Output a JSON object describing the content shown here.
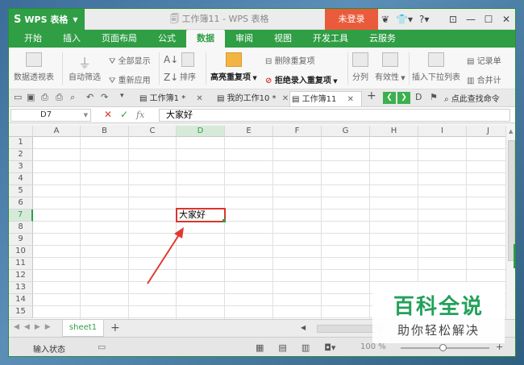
{
  "titlebar": {
    "app_name": "WPS 表格",
    "app_logo": "S",
    "title": "工作簿11 - WPS 表格",
    "login_label": "未登录",
    "icons": [
      "bird-icon",
      "shirt-icon",
      "help-icon",
      "pin-icon"
    ]
  },
  "menu": {
    "tabs": [
      "开始",
      "插入",
      "页面布局",
      "公式",
      "数据",
      "审阅",
      "视图",
      "开发工具",
      "云服务"
    ],
    "active": "数据"
  },
  "ribbon": {
    "pivot": "数据透视表",
    "autofilter": "自动筛选",
    "show_all": "全部显示",
    "reapply": "重新应用",
    "sort": "排序",
    "highlight_dup": "高亮重复项",
    "delete_dup": "删除重复项",
    "reject_dup": "拒绝录入重复项",
    "split": "分列",
    "validity": "有效性",
    "dropdown": "插入下拉列表",
    "record": "记录单",
    "merge": "合并计"
  },
  "doctabs": {
    "tabs": [
      {
        "label": "工作簿1 *"
      },
      {
        "label": "我的工作10 *"
      },
      {
        "label": "工作簿11"
      }
    ],
    "find_command": "点此查找命令"
  },
  "formula_bar": {
    "cell_ref": "D7",
    "fx": "fx",
    "value": "大家好"
  },
  "grid": {
    "columns": [
      "A",
      "B",
      "C",
      "D",
      "E",
      "F",
      "G",
      "H",
      "I",
      "J"
    ],
    "rows": [
      "1",
      "2",
      "3",
      "4",
      "5",
      "6",
      "7",
      "8",
      "9",
      "10",
      "11",
      "12",
      "13",
      "14",
      "15"
    ],
    "selected_col": "D",
    "selected_row": "7",
    "cell_d7": "大家好"
  },
  "sheets": {
    "tabs": [
      "sheet1"
    ]
  },
  "status": {
    "mode": "输入状态",
    "zoom": "100 %"
  },
  "watermark": {
    "title": "百科全说",
    "subtitle": "助你轻松解决"
  },
  "colors": {
    "accent": "#2f9e45",
    "login": "#e95b3a",
    "highlight": "#d9362c"
  }
}
